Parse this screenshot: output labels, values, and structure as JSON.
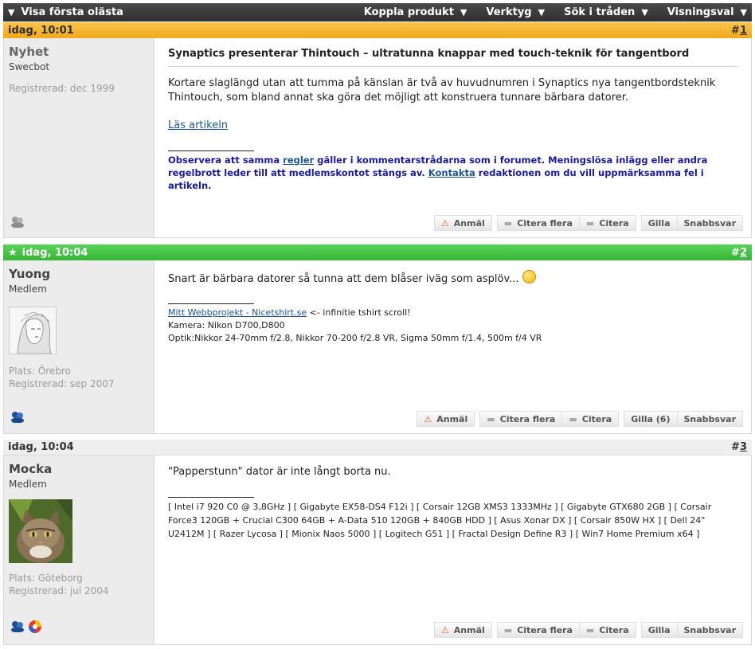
{
  "topbar": {
    "first_unread": "Visa första olästa",
    "menus": [
      "Koppla produkt",
      "Verktyg",
      "Sök i tråden",
      "Visningsval"
    ]
  },
  "posts": [
    {
      "time": "idag, 10:01",
      "number_prefix": "#",
      "number": "1",
      "username": "Nyhet",
      "user_title": "Swecbot",
      "registered": "Registrerad: dec 1999",
      "title": "Synaptics presenterar Thintouch – ultratunna knappar med touch-teknik för tangentbord",
      "text": "Kortare slaglängd utan att tumma på känslan är två av huvudnumren i Synaptics nya tangentbordsteknik Thintouch, som bland annat ska göra det möjligt att konstruera tunnare bärbara datorer.",
      "read_link": "Läs artikeln",
      "notice": {
        "part1": "Observera att samma ",
        "link1": "regler",
        "part2": " gäller i kommentarstrådarna som i forumet. Meningslösa inlägg eller andra regelbrott leder till att medlemskontot stängs av. ",
        "link2": "Kontakta",
        "part3": " redaktionen om du vill uppmärksamma fel i artikeln."
      },
      "actions": [
        "Anmäl",
        "Citera flera",
        "Citera",
        "Gilla",
        "Snabbsvar"
      ]
    },
    {
      "time": "idag, 10:04",
      "number_prefix": "#",
      "number": "2",
      "username": "Yuong",
      "user_title": "Medlem",
      "location": "Plats: Örebro",
      "registered": "Registrerad: sep 2007",
      "text": "Snart är bärbara datorer så tunna att dem blåser iväg som asplöv...",
      "sig_link": "Mitt Webbprojekt - Nicetshirt.se",
      "sig_link_suffix": " <- infinitie tshirt scroll!",
      "sig_line2": "Kamera: Nikon D700,D800",
      "sig_line3": "Optik:Nikkor 24-70mm f/2.8, Nikkor 70-200 f/2.8 VR, Sigma 50mm f/1.4, 500m f/4 VR",
      "actions": [
        "Anmäl",
        "Citera flera",
        "Citera",
        "Gilla (6)",
        "Snabbsvar"
      ]
    },
    {
      "time": "idag, 10:04",
      "number_prefix": "#",
      "number": "3",
      "username": "Mocka",
      "user_title": "Medlem",
      "location": "Plats: Göteborg",
      "registered": "Registrerad: jul 2004",
      "text": "\"Papperstunn\" dator är inte långt borta nu.",
      "sig_text": "[ Intel i7 920 C0 @ 3,8GHz ] [ Gigabyte EX58-DS4 F12i ] [ Corsair 12GB XMS3 1333MHz ] [ Gigabyte GTX680 2GB ] [ Corsair Force3 120GB + Crucial C300 64GB + A-Data 510 120GB + 840GB HDD ] [ Asus Xonar DX ] [ Corsair 850W HX ] [ Dell 24\" U2412M ] [ Razer Lycosa ] [ Mionix Naos 5000 ] [ Logitech G51 ] [ Fractal Design Define R3 ] [ Win7 Home Premium x64 ]",
      "actions": [
        "Anmäl",
        "Citera flera",
        "Citera",
        "Gilla",
        "Snabbsvar"
      ]
    }
  ],
  "colors": {
    "header_new": "#f0a91d",
    "header_green": "#35b635",
    "header_read": "#eeeeee",
    "link": "#1b5599",
    "notice": "#1a1aa0"
  }
}
